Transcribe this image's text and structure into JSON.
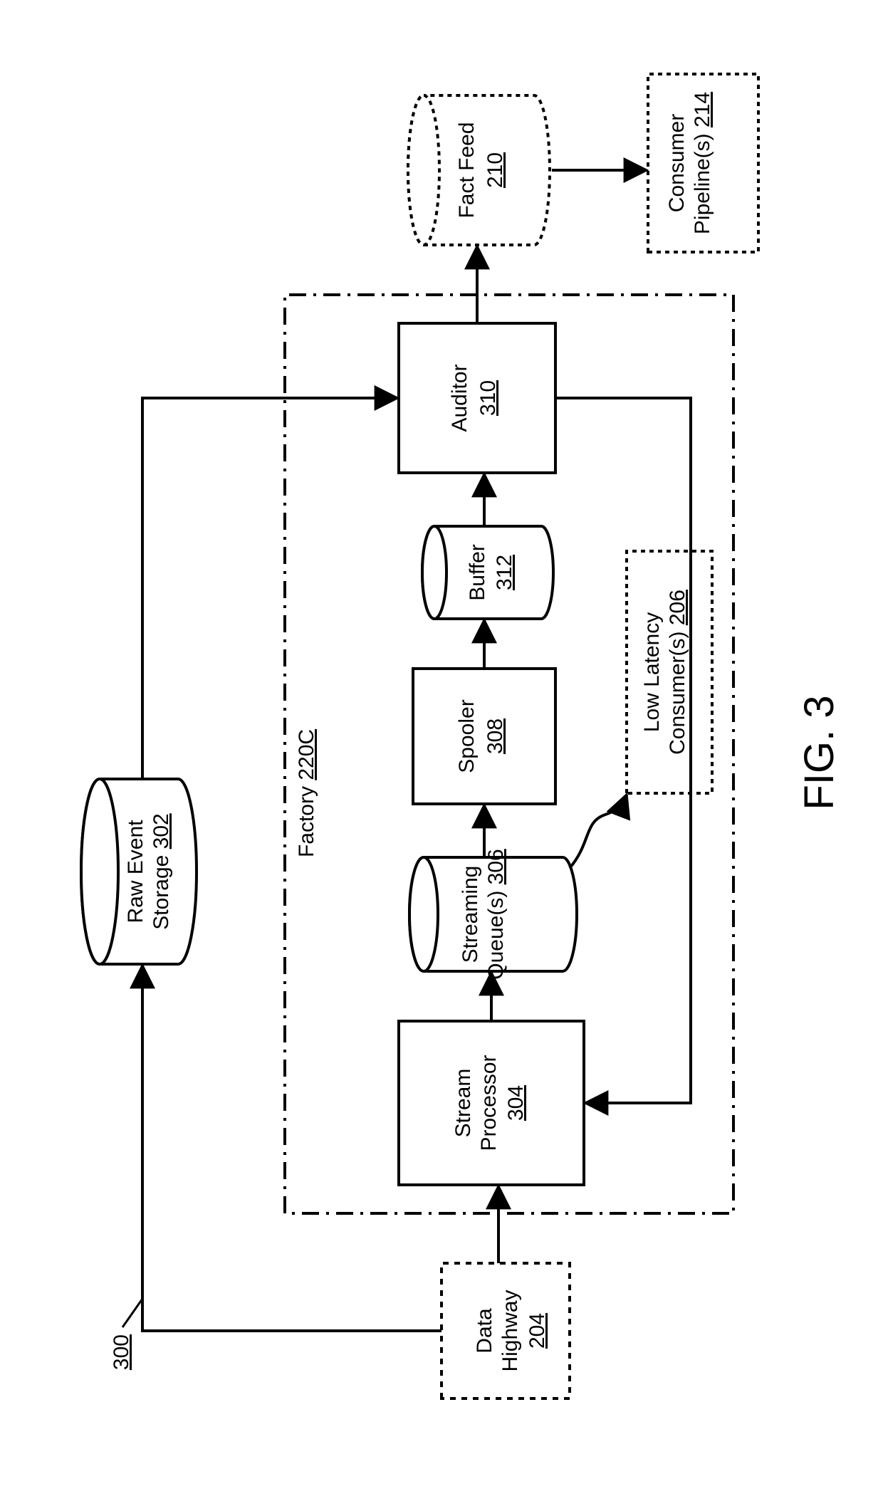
{
  "figure": {
    "caption": "FIG. 3",
    "diagram_ref": "300"
  },
  "nodes": {
    "raw_event_storage": {
      "label": "Raw Event",
      "label2": "Storage",
      "ref": "302"
    },
    "data_highway": {
      "label": "Data",
      "label2": "Highway",
      "ref": "204"
    },
    "factory": {
      "label": "Factory",
      "ref": "220C"
    },
    "stream_processor": {
      "label": "Stream",
      "label2": "Processor",
      "ref": "304"
    },
    "streaming_queue": {
      "label": "Streaming",
      "label2": "Queue(s)",
      "ref": "306"
    },
    "spooler": {
      "label": "Spooler",
      "ref": "308"
    },
    "buffer": {
      "label": "Buffer",
      "ref": "312"
    },
    "auditor": {
      "label": "Auditor",
      "ref": "310"
    },
    "low_latency": {
      "label": "Low Latency",
      "label2": "Consumer(s)",
      "ref": "206"
    },
    "fact_feed": {
      "label": "Fact Feed",
      "ref": "210"
    },
    "consumer_pipeline": {
      "label": "Consumer",
      "label2": "Pipeline(s)",
      "ref": "214"
    }
  }
}
